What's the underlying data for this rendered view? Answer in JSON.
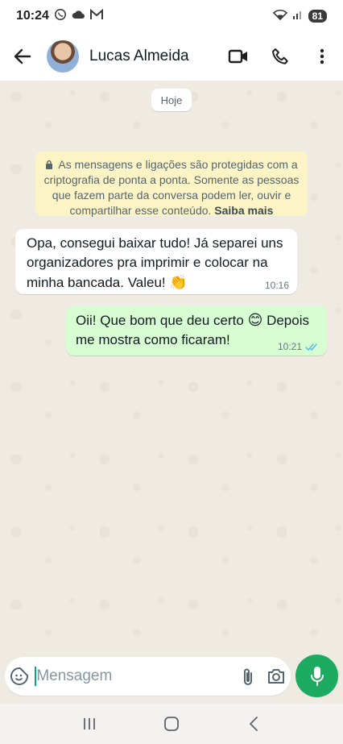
{
  "status_bar": {
    "time": "10:24",
    "battery": "81",
    "icons": [
      "whatsapp-icon",
      "cloud-icon",
      "gmail-icon",
      "wifi-icon",
      "signal-icon"
    ]
  },
  "header": {
    "contact_name": "Lucas Almeida",
    "icons": [
      "back-arrow-icon",
      "video-call-icon",
      "phone-icon",
      "more-vert-icon"
    ]
  },
  "chat": {
    "date_chip": "Hoje",
    "encryption_notice": "As mensagens e ligações são protegidas com a criptografia de ponta a ponta. Somente as pessoas que fazem parte da conversa podem ler, ouvir e compartilhar esse conteúdo.",
    "encryption_link": "Saiba mais",
    "messages": [
      {
        "direction": "incoming",
        "text": "Opa, consegui baixar tudo! Já separei uns organizadores pra imprimir e colocar na minha bancada. Valeu!",
        "emoji": "👏",
        "time": "10:16"
      },
      {
        "direction": "outgoing",
        "text_before": "Oii! Que bom que deu certo",
        "emoji": "😊",
        "text_after": "Depois me mostra como ficaram!",
        "time": "10:21",
        "status": "read"
      }
    ]
  },
  "composer": {
    "placeholder": "Mensagem",
    "icons": [
      "sticker-icon",
      "attach-icon",
      "camera-icon",
      "mic-icon"
    ]
  },
  "colors": {
    "accent": "#1daa61",
    "outgoing_bubble": "#d9fdd3",
    "incoming_bubble": "#ffffff",
    "encryption_bg": "#fdf4c5",
    "read_ticks": "#53bdeb"
  }
}
